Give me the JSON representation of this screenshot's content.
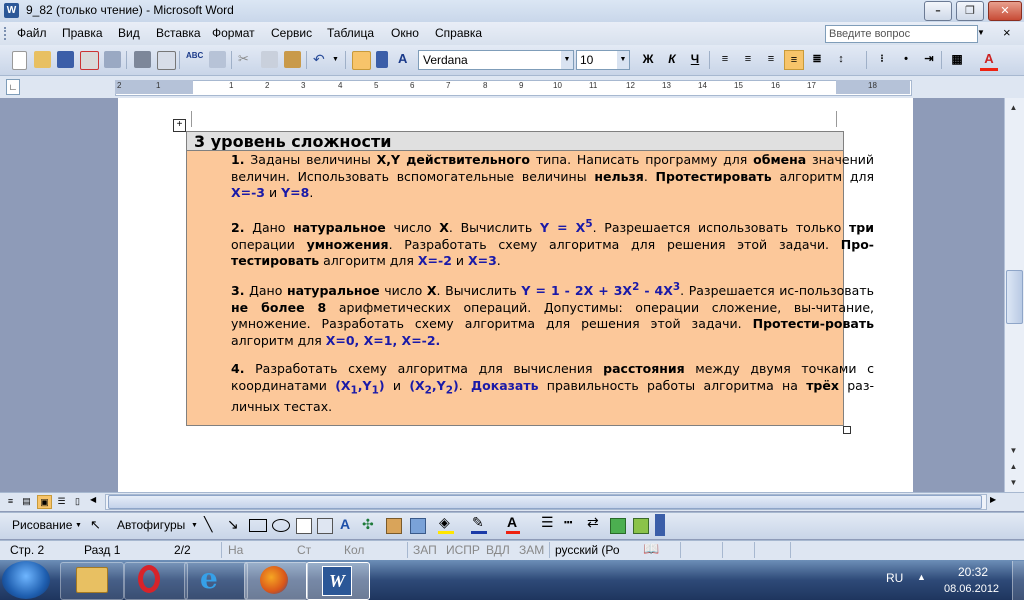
{
  "window": {
    "title": "9_82 (только чтение) - Microsoft Word",
    "app_icon": "W"
  },
  "menu": {
    "items": [
      "Файл",
      "Правка",
      "Вид",
      "Вставка",
      "Формат",
      "Сервис",
      "Таблица",
      "Окно",
      "Справка"
    ],
    "help_placeholder": "Введите вопрос"
  },
  "toolbar": {
    "font": "Verdana",
    "size": "10",
    "bold": "Ж",
    "italic": "К",
    "underline": "Ч",
    "style_icon": "A"
  },
  "ruler": {
    "marks": [
      "2",
      "1",
      "1",
      "2",
      "3",
      "4",
      "5",
      "6",
      "7",
      "8",
      "9",
      "10",
      "11",
      "12",
      "13",
      "14",
      "15",
      "16",
      "17",
      "18"
    ]
  },
  "doc": {
    "heading": "3 уровень сложности",
    "tasks": [
      {
        "num": "1.",
        "text": [
          "Заданы величины ",
          "X,Y действительного",
          " типа. Написать программу для ",
          "обмена",
          " значений величин. Использовать  вспомогательные величины ",
          "нельзя",
          ". ",
          "Протестировать",
          " алгоритм для ",
          "X=-3",
          " и ",
          "Y=8",
          "."
        ]
      },
      {
        "num": "2.",
        "text": [
          "Дано ",
          "натуральное",
          " число ",
          "X",
          ". Вычислить ",
          "Y = X",
          "5",
          ". Разрешается использовать только ",
          "три",
          " операции ",
          "умножения",
          ". Разработать схему алгоритма для решения этой задачи. ",
          "Про-тестировать",
          " алгоритм для ",
          "X=-2",
          " и ",
          "X=3",
          "."
        ]
      },
      {
        "num": "3.",
        "text": [
          "Дано ",
          "натуральное",
          " число ",
          "X",
          ". Вычислить ",
          "Y = 1 - 2X + 3X",
          "2",
          " - 4X",
          "3",
          ". Разрешается ис-пользовать ",
          "не более 8",
          " арифметических операций. Допустимы:  операции сложение, вы-читание, умножение. Разработать схему алгоритма для решения этой задачи. ",
          "Протести-ровать",
          " алгоритм для ",
          "X=0, X=1, X=-2."
        ]
      },
      {
        "num": "4.",
        "text": [
          "Разработать схему алгоритма для вычисления ",
          "расстояния",
          " между двумя точками с координатами ",
          "(X",
          "1",
          ",Y",
          "1",
          ")",
          " и ",
          "(X",
          "2",
          ",Y",
          "2",
          ")",
          ". ",
          "Доказать",
          " правильность работы алгоритма на ",
          "трёх",
          " раз-личных тестах."
        ]
      }
    ]
  },
  "drawbar": {
    "draw": "Рисование",
    "autoshapes": "Автофигуры"
  },
  "status": {
    "page": "Стр. 2",
    "section": "Разд 1",
    "pages": "2/2",
    "at": "На",
    "line": "Ст",
    "col": "Кол",
    "rec": "ЗАП",
    "trk": "ИСПР",
    "ext": "ВДЛ",
    "ovr": "ЗАМ",
    "lang": "русский (Ро"
  },
  "taskbar": {
    "lang": "RU",
    "time": "20:32",
    "date": "08.06.2012"
  }
}
